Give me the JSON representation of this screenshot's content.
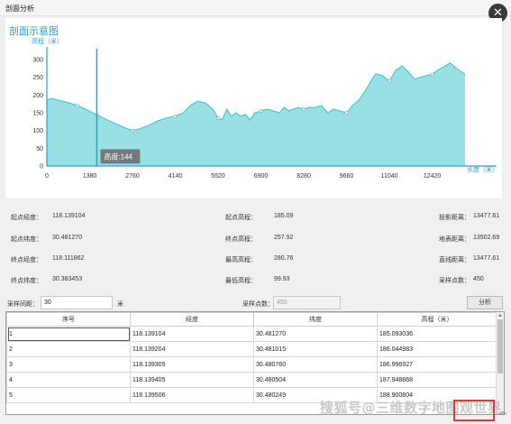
{
  "window": {
    "title": "剖面分析",
    "close_icon": "close-icon"
  },
  "chart": {
    "title": "剖面示意图",
    "ylabel": "高程（米）",
    "xlabel": "长度（米）",
    "tooltip": "高度:144"
  },
  "chart_data": {
    "type": "area",
    "xlabel": "长度（米）",
    "ylabel": "高程（米）",
    "x_ticks": [
      0,
      1380,
      2760,
      4140,
      5520,
      6900,
      8280,
      9660,
      11040,
      12420
    ],
    "y_ticks": [
      0,
      50,
      100,
      150,
      200,
      250,
      300
    ],
    "xlim": [
      0,
      13477.61
    ],
    "ylim": [
      0,
      310
    ],
    "fill_color": "#8ddde0",
    "line_color": "#3fbfc4",
    "cursor": {
      "x": 1610,
      "y": 144,
      "label": "高度:144"
    },
    "x": [
      0,
      150,
      400,
      700,
      1000,
      1200,
      1610,
      1900,
      2200,
      2500,
      2760,
      3000,
      3300,
      3600,
      3900,
      4140,
      4400,
      4650,
      4850,
      5100,
      5350,
      5520,
      5650,
      5800,
      5950,
      6100,
      6250,
      6400,
      6550,
      6700,
      6900,
      7100,
      7300,
      7500,
      7650,
      7800,
      7950,
      8100,
      8280,
      8450,
      8650,
      8850,
      9050,
      9250,
      9450,
      9660,
      9850,
      10050,
      10250,
      10450,
      10600,
      10800,
      11040,
      11250,
      11450,
      11650,
      11850,
      12050,
      12250,
      12420,
      12600,
      12800,
      13000,
      13200,
      13477
    ],
    "y": [
      185,
      190,
      185,
      178,
      170,
      162,
      144,
      132,
      120,
      108,
      100,
      105,
      115,
      128,
      136,
      140,
      150,
      172,
      182,
      178,
      160,
      135,
      130,
      160,
      140,
      150,
      140,
      145,
      130,
      150,
      155,
      160,
      155,
      150,
      165,
      155,
      160,
      165,
      160,
      165,
      165,
      170,
      150,
      160,
      155,
      150,
      170,
      185,
      210,
      240,
      260,
      255,
      240,
      270,
      282,
      265,
      245,
      250,
      255,
      258,
      270,
      280,
      290,
      275,
      258
    ]
  },
  "stats": {
    "start_lon_label": "起点经度：",
    "start_lon": "118.139104",
    "start_lat_label": "起点纬度：",
    "start_lat": "30.481270",
    "end_lon_label": "终点经度：",
    "end_lon": "118.111862",
    "end_lat_label": "终点纬度：",
    "end_lat": "30.383453",
    "start_elev_label": "起点高程：",
    "start_elev": "185.09",
    "end_elev_label": "终点高程：",
    "end_elev": "257.92",
    "max_elev_label": "最高高程：",
    "max_elev": "280.76",
    "min_elev_label": "最低高程：",
    "min_elev": "99.93",
    "proj_dist_label": "投影距离：",
    "proj_dist": "13477.61",
    "surface_dist_label": "地表距离：",
    "surface_dist": "13502.69",
    "straight_dist_label": "直线距离：",
    "straight_dist": "13477.61",
    "sample_count_label": "采样点数：",
    "sample_count": "450"
  },
  "sampling": {
    "interval_label": "采样间距：",
    "interval_value": "30",
    "interval_unit": "米",
    "points_label": "采样点数：",
    "points_value": "450",
    "analyze_button": "分析"
  },
  "table": {
    "headers": [
      "序号",
      "经度",
      "纬度",
      "高程（米）"
    ],
    "rows": [
      [
        "1",
        "118.139104",
        "30.481270",
        "185.093036"
      ],
      [
        "2",
        "118.139204",
        "30.481015",
        "186.044983"
      ],
      [
        "3",
        "118.139305",
        "30.480760",
        "186.996927"
      ],
      [
        "4",
        "118.139405",
        "30.480504",
        "187.948868"
      ],
      [
        "5",
        "118.139506",
        "30.480249",
        "188.900804"
      ]
    ]
  },
  "watermark": "搜狐号@三维数字地图观世界",
  "scroll_top_icon": "chevron-up-icon"
}
